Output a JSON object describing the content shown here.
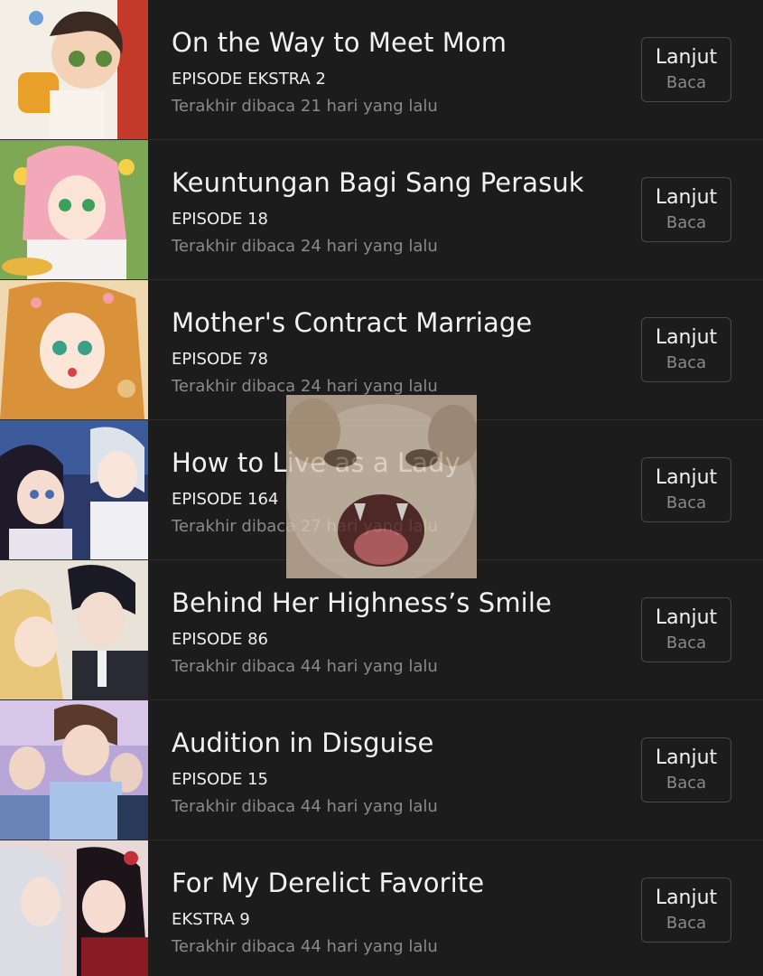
{
  "history": {
    "items": [
      {
        "title": "On the Way to Meet Mom",
        "episode": "EPISODE EKSTRA 2",
        "last_read": "Terakhir dibaca 21 hari yang lalu",
        "btn_line1": "Lanjut",
        "btn_line2": "Baca"
      },
      {
        "title": "Keuntungan Bagi Sang Perasuk",
        "episode": "EPISODE 18",
        "last_read": "Terakhir dibaca 24 hari yang lalu",
        "btn_line1": "Lanjut",
        "btn_line2": "Baca"
      },
      {
        "title": "Mother's Contract Marriage",
        "episode": "EPISODE 78",
        "last_read": "Terakhir dibaca 24 hari yang lalu",
        "btn_line1": "Lanjut",
        "btn_line2": "Baca"
      },
      {
        "title": "How to Live as a Lady",
        "episode": "EPISODE 164",
        "last_read": "Terakhir dibaca 27 hari yang lalu",
        "btn_line1": "Lanjut",
        "btn_line2": "Baca"
      },
      {
        "title": "Behind Her Highness’s Smile",
        "episode": "EPISODE 86",
        "last_read": "Terakhir dibaca 44 hari yang lalu",
        "btn_line1": "Lanjut",
        "btn_line2": "Baca"
      },
      {
        "title": "Audition in Disguise",
        "episode": "EPISODE 15",
        "last_read": "Terakhir dibaca 44 hari yang lalu",
        "btn_line1": "Lanjut",
        "btn_line2": "Baca"
      },
      {
        "title": "For My Derelict Favorite",
        "episode": "EKSTRA 9",
        "last_read": "Terakhir dibaca 44 hari yang lalu",
        "btn_line1": "Lanjut",
        "btn_line2": "Baca"
      }
    ]
  },
  "colors": {
    "background": "#1c1c1c",
    "title_text": "#f2f2f2",
    "secondary_text": "#8a8a8a",
    "button_border": "#4a4a4a"
  },
  "icons": {
    "overlay": "cat-meme-sticker"
  }
}
